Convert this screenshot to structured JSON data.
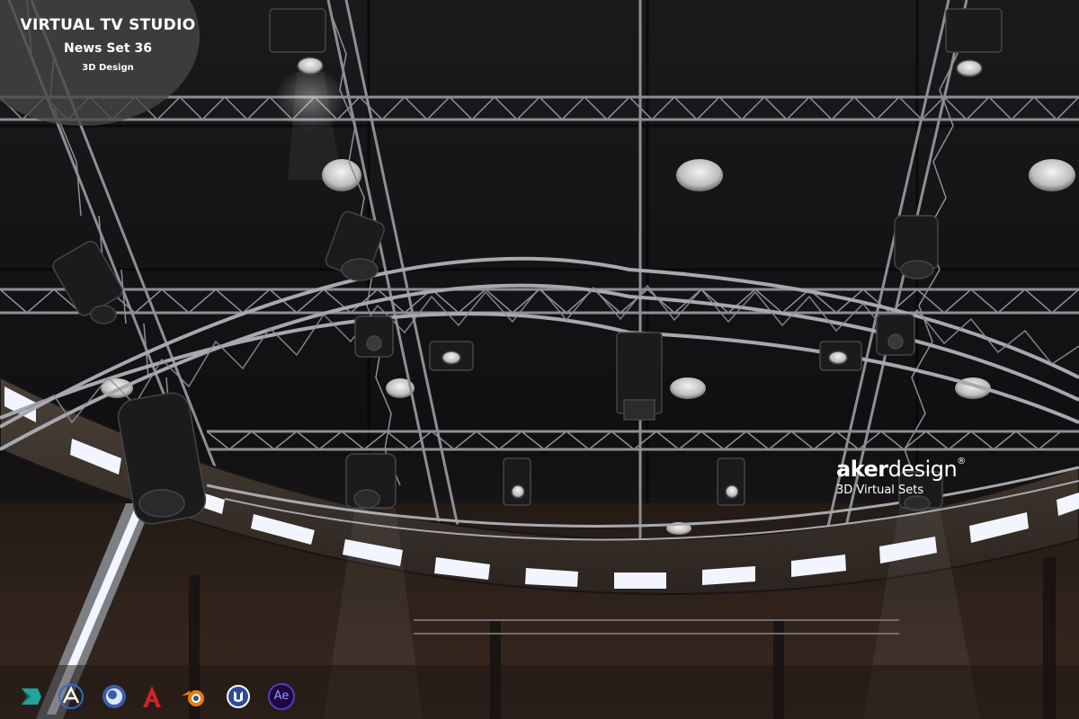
{
  "title": {
    "main": "VIRTUAL TV STUDIO",
    "sub": "News Set 36",
    "small": "3D Design"
  },
  "brand": {
    "logo_bold": "aker",
    "logo_light": "design",
    "registered": "®",
    "tagline": "3D Virtual Sets"
  },
  "software_icons": [
    {
      "icon": "3ds-max-icon",
      "color": "#1fa39a"
    },
    {
      "icon": "unreal-aximmetry-icon",
      "color": "#2a6fc4"
    },
    {
      "icon": "cinema4d-icon",
      "color": "#3b5ea8"
    },
    {
      "icon": "autocad-icon",
      "color": "#d32026"
    },
    {
      "icon": "blender-icon",
      "color": "#e87d0d"
    },
    {
      "icon": "unreal-engine-icon",
      "color": "#2b4a9a"
    },
    {
      "icon": "after-effects-icon",
      "label": "Ae",
      "color": "#9999ff",
      "bg": "#1f0740"
    }
  ],
  "colors": {
    "ceiling": "#121214",
    "truss": "#8a8d92",
    "led": "#f2f5ff",
    "floor_band": "#3a3430"
  }
}
